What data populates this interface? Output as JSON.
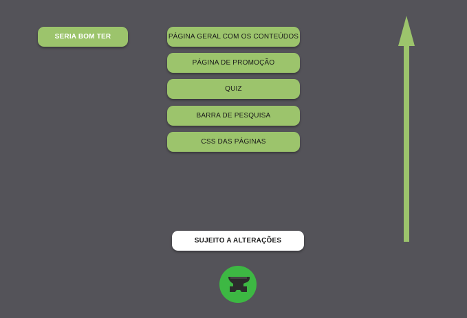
{
  "heading": {
    "label": "SERIA BOM TER"
  },
  "items": [
    {
      "label": "PÁGINA GERAL COM OS CONTEÚDOS"
    },
    {
      "label": "PÁGINA DE PROMOÇÃO"
    },
    {
      "label": "QUIZ"
    },
    {
      "label": "BARRA DE PESQUISA"
    },
    {
      "label": "CSS DAS PÁGINAS"
    }
  ],
  "note": {
    "label": "SUJEITO A ALTERAÇÕES"
  },
  "colors": {
    "background": "#545359",
    "green": "#9cc46c",
    "logo_green": "#3db843",
    "note_background": "#ffffff"
  },
  "icons": {
    "arrow": "up-arrow-icon",
    "logo": "anvil-logo-icon"
  }
}
